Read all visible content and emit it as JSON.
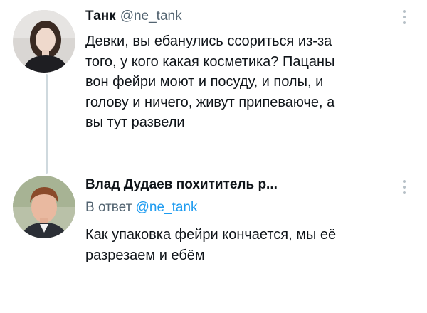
{
  "tweet1": {
    "author_name": "Танк",
    "author_handle": "@ne_tank",
    "text": "Девки, вы ебанулись ссориться из-за\nтого, у кого какая косметика? Пацаны\nвон фейри моют и посуду, и полы, и\nголову и ничего, живут припеваюче, а\nвы тут развели",
    "more_icon": "more-vertical-icon"
  },
  "tweet2": {
    "author_name": "Влад Дудаев похититель р...",
    "reply_prefix": "В ответ",
    "reply_mention": "@ne_tank",
    "text": "Как упаковка фейри кончается, мы её\nразрезаем и ебём",
    "more_icon": "more-vertical-icon"
  },
  "colors": {
    "text": "#0f1419",
    "secondary": "#536471",
    "mention": "#1d9bf0",
    "thread_line": "#cfd9de"
  }
}
